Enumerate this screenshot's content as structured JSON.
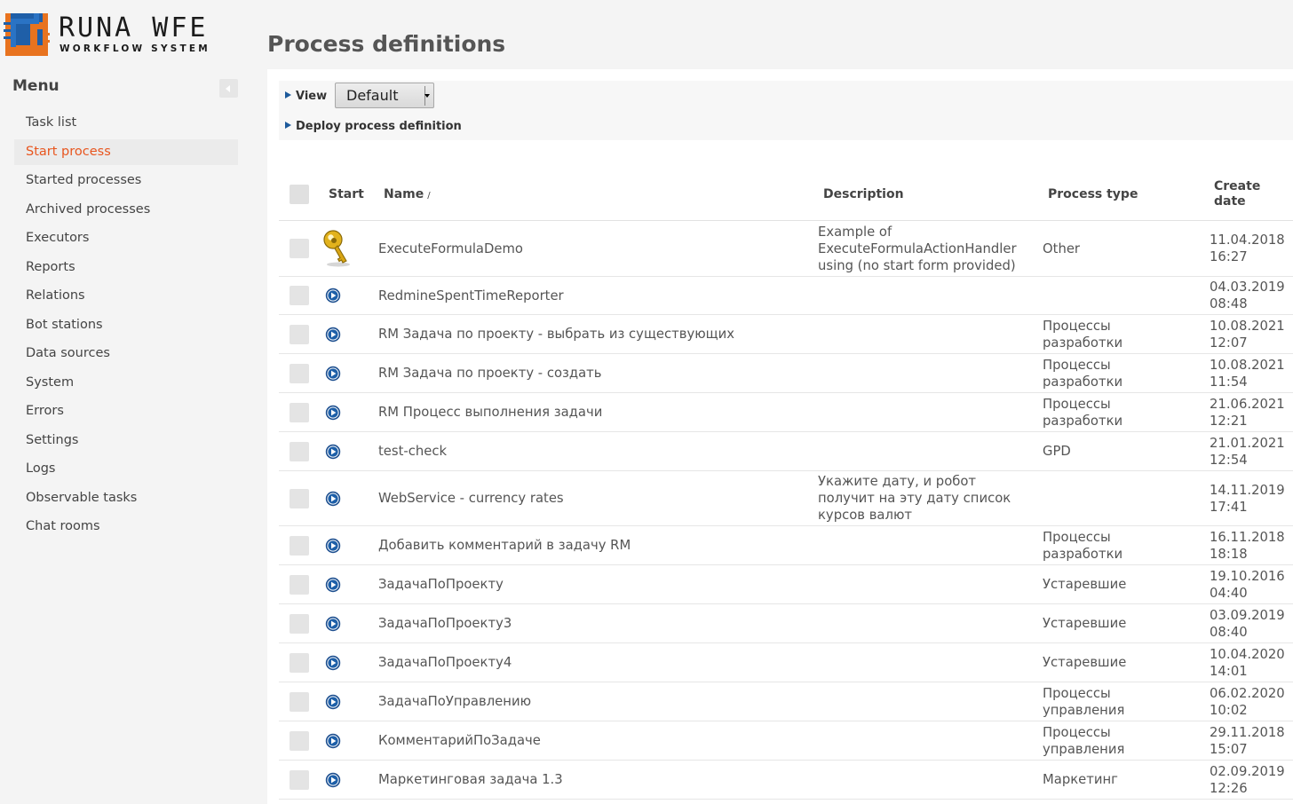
{
  "brand": {
    "title": "RUNA WFE",
    "subtitle": "WORKFLOW SYSTEM",
    "colors": {
      "orange": "#e8731f",
      "blue": "#1f5fa8"
    }
  },
  "menu": {
    "title": "Menu",
    "collapse_icon": "chevron-left-icon",
    "items": [
      {
        "label": "Task list"
      },
      {
        "label": "Start process",
        "active": true
      },
      {
        "label": "Started processes"
      },
      {
        "label": "Archived processes"
      },
      {
        "label": "Executors"
      },
      {
        "label": "Reports"
      },
      {
        "label": "Relations"
      },
      {
        "label": "Bot stations"
      },
      {
        "label": "Data sources"
      },
      {
        "label": "System"
      },
      {
        "label": "Errors"
      },
      {
        "label": "Settings"
      },
      {
        "label": "Logs"
      },
      {
        "label": "Observable tasks"
      },
      {
        "label": "Chat rooms"
      }
    ],
    "active_color": "#e8561f"
  },
  "page": {
    "title": "Process definitions"
  },
  "controls": {
    "view_label": "View",
    "view_value": "Default",
    "deploy_label": "Deploy process definition"
  },
  "table": {
    "headers": {
      "start": "Start",
      "name": "Name",
      "sort_indicator": "/",
      "description": "Description",
      "process_type": "Process type",
      "create_date_line1": "Create",
      "create_date_line2": "date"
    },
    "rows": [
      {
        "icon": "key-icon",
        "name": "ExecuteFormulaDemo",
        "description": [
          "Example of",
          "ExecuteFormulaActionHandler",
          "using (no start form provided)"
        ],
        "type": [
          "Other"
        ],
        "date": "11.04.2018",
        "time": "16:27"
      },
      {
        "icon": "play-icon",
        "name": "RedmineSpentTimeReporter",
        "description": [],
        "type": [],
        "date": "04.03.2019",
        "time": "08:48"
      },
      {
        "icon": "play-icon",
        "name": "RM Задача по проекту - выбрать из существующих",
        "description": [],
        "type": [
          "Процессы",
          "разработки"
        ],
        "date": "10.08.2021",
        "time": "12:07"
      },
      {
        "icon": "play-icon",
        "name": "RM Задача по проекту - создать",
        "description": [],
        "type": [
          "Процессы",
          "разработки"
        ],
        "date": "10.08.2021",
        "time": "11:54"
      },
      {
        "icon": "play-icon",
        "name": "RM Процесс выполнения задачи",
        "description": [],
        "type": [
          "Процессы",
          "разработки"
        ],
        "date": "21.06.2021",
        "time": "12:21"
      },
      {
        "icon": "play-icon",
        "name": "test-check",
        "description": [],
        "type": [
          "GPD"
        ],
        "date": "21.01.2021",
        "time": "12:54"
      },
      {
        "icon": "play-icon",
        "name": "WebService - currency rates",
        "description": [
          "Укажите дату, и робот",
          "получит на эту дату список",
          "курсов валют"
        ],
        "type": [],
        "date": "14.11.2019",
        "time": "17:41"
      },
      {
        "icon": "play-icon",
        "name": "Добавить комментарий в задачу RM",
        "description": [],
        "type": [
          "Процессы",
          "разработки"
        ],
        "date": "16.11.2018",
        "time": "18:18"
      },
      {
        "icon": "play-icon",
        "name": "ЗадачаПоПроекту",
        "description": [],
        "type": [
          "Устаревшие"
        ],
        "date": "19.10.2016",
        "time": "04:40"
      },
      {
        "icon": "play-icon",
        "name": "ЗадачаПоПроекту3",
        "description": [],
        "type": [
          "Устаревшие"
        ],
        "date": "03.09.2019",
        "time": "08:40"
      },
      {
        "icon": "play-icon",
        "name": "ЗадачаПоПроекту4",
        "description": [],
        "type": [
          "Устаревшие"
        ],
        "date": "10.04.2020",
        "time": "14:01"
      },
      {
        "icon": "play-icon",
        "name": "ЗадачаПоУправлению",
        "description": [],
        "type": [
          "Процессы",
          "управления"
        ],
        "date": "06.02.2020",
        "time": "10:02"
      },
      {
        "icon": "play-icon",
        "name": "КомментарийПоЗадаче",
        "description": [],
        "type": [
          "Процессы",
          "управления"
        ],
        "date": "29.11.2018",
        "time": "15:07"
      },
      {
        "icon": "play-icon",
        "name": "Маркетинговая задача 1.3",
        "description": [],
        "type": [
          "Маркетинг"
        ],
        "date": "02.09.2019",
        "time": "12:26"
      }
    ]
  }
}
